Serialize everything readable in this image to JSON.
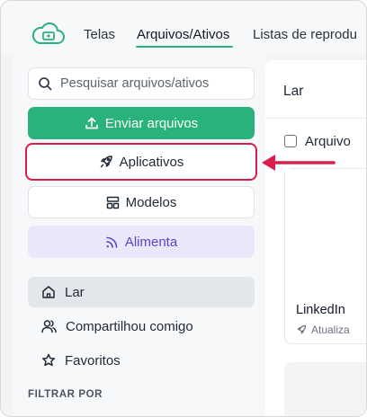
{
  "topnav": {
    "tabs": [
      {
        "label": "Telas"
      },
      {
        "label": "Arquivos/Ativos",
        "active": true
      },
      {
        "label": "Listas de reprodu"
      }
    ]
  },
  "sidebar": {
    "search": {
      "placeholder": "Pesquisar arquivos/ativos"
    },
    "upload_label": "Enviar arquivos",
    "apps_label": "Aplicativos",
    "models_label": "Modelos",
    "feed_label": "Alimenta",
    "nav": [
      {
        "label": "Lar",
        "icon": "home-icon"
      },
      {
        "label": "Compartilhou comigo",
        "icon": "users-icon"
      },
      {
        "label": "Favoritos",
        "icon": "star-icon"
      }
    ],
    "filter_label": "FILTRAR POR"
  },
  "main": {
    "title": "Lar",
    "column_label": "Arquivo",
    "card": {
      "title": "LinkedIn",
      "meta": "Atualiza"
    }
  },
  "colors": {
    "brand_green": "#2ab27b",
    "highlight_red": "#d81e4d",
    "feed_purple": "#5b44c6"
  }
}
